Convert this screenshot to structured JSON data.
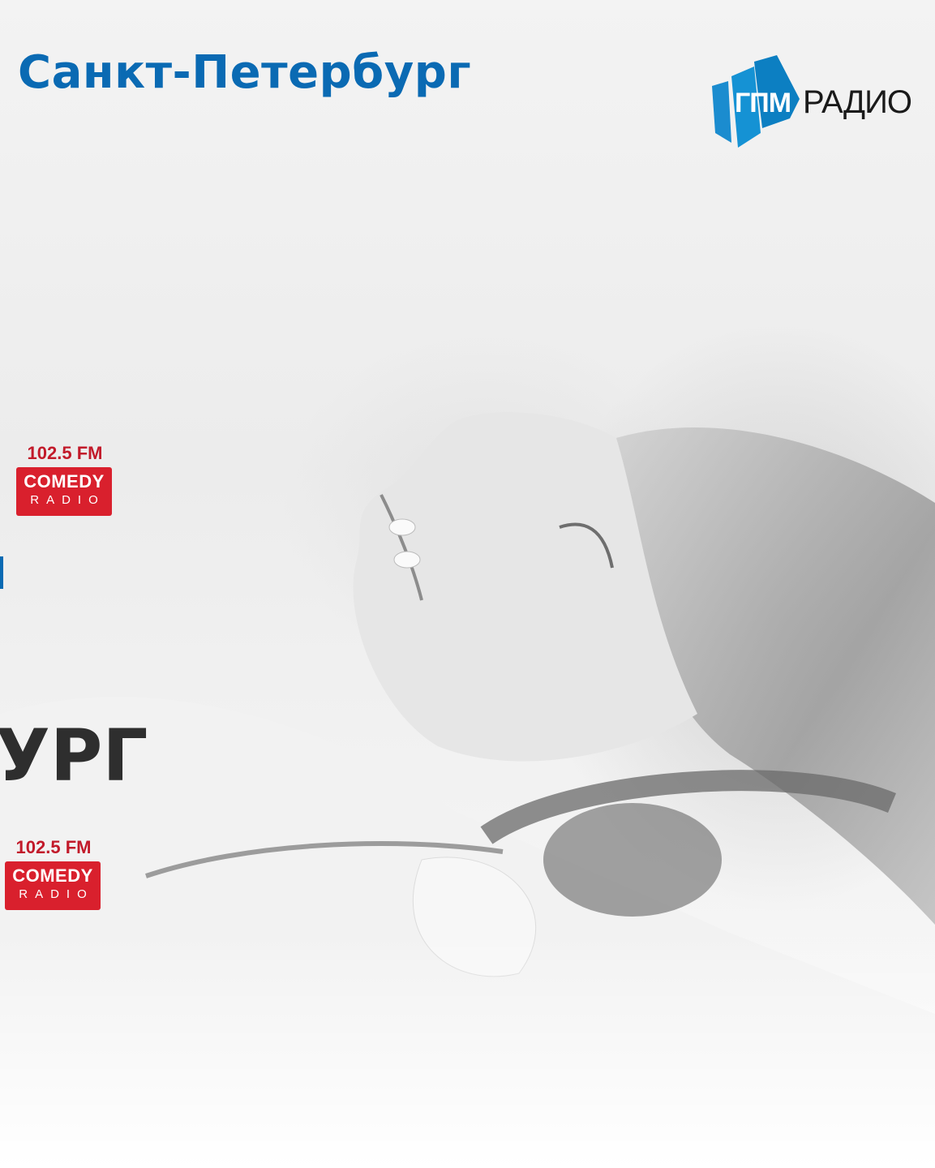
{
  "page": {
    "title": "Санкт-Петербург"
  },
  "brand": {
    "logo_left": "ГПМ",
    "logo_right": "РАДИО",
    "accent_color": "#0a6ab3"
  },
  "stations": [
    {
      "frequency": "102.5 FM",
      "name_top": "COMEDY",
      "name_bottom": "RADIO",
      "color": "#d9202d"
    },
    {
      "frequency": "102.5 FM",
      "name_top": "COMEDY",
      "name_bottom": "RADIO",
      "color": "#d9202d"
    }
  ],
  "partial_heading": "УРГ",
  "background": {
    "subject": "woman-with-headphones-photo"
  }
}
